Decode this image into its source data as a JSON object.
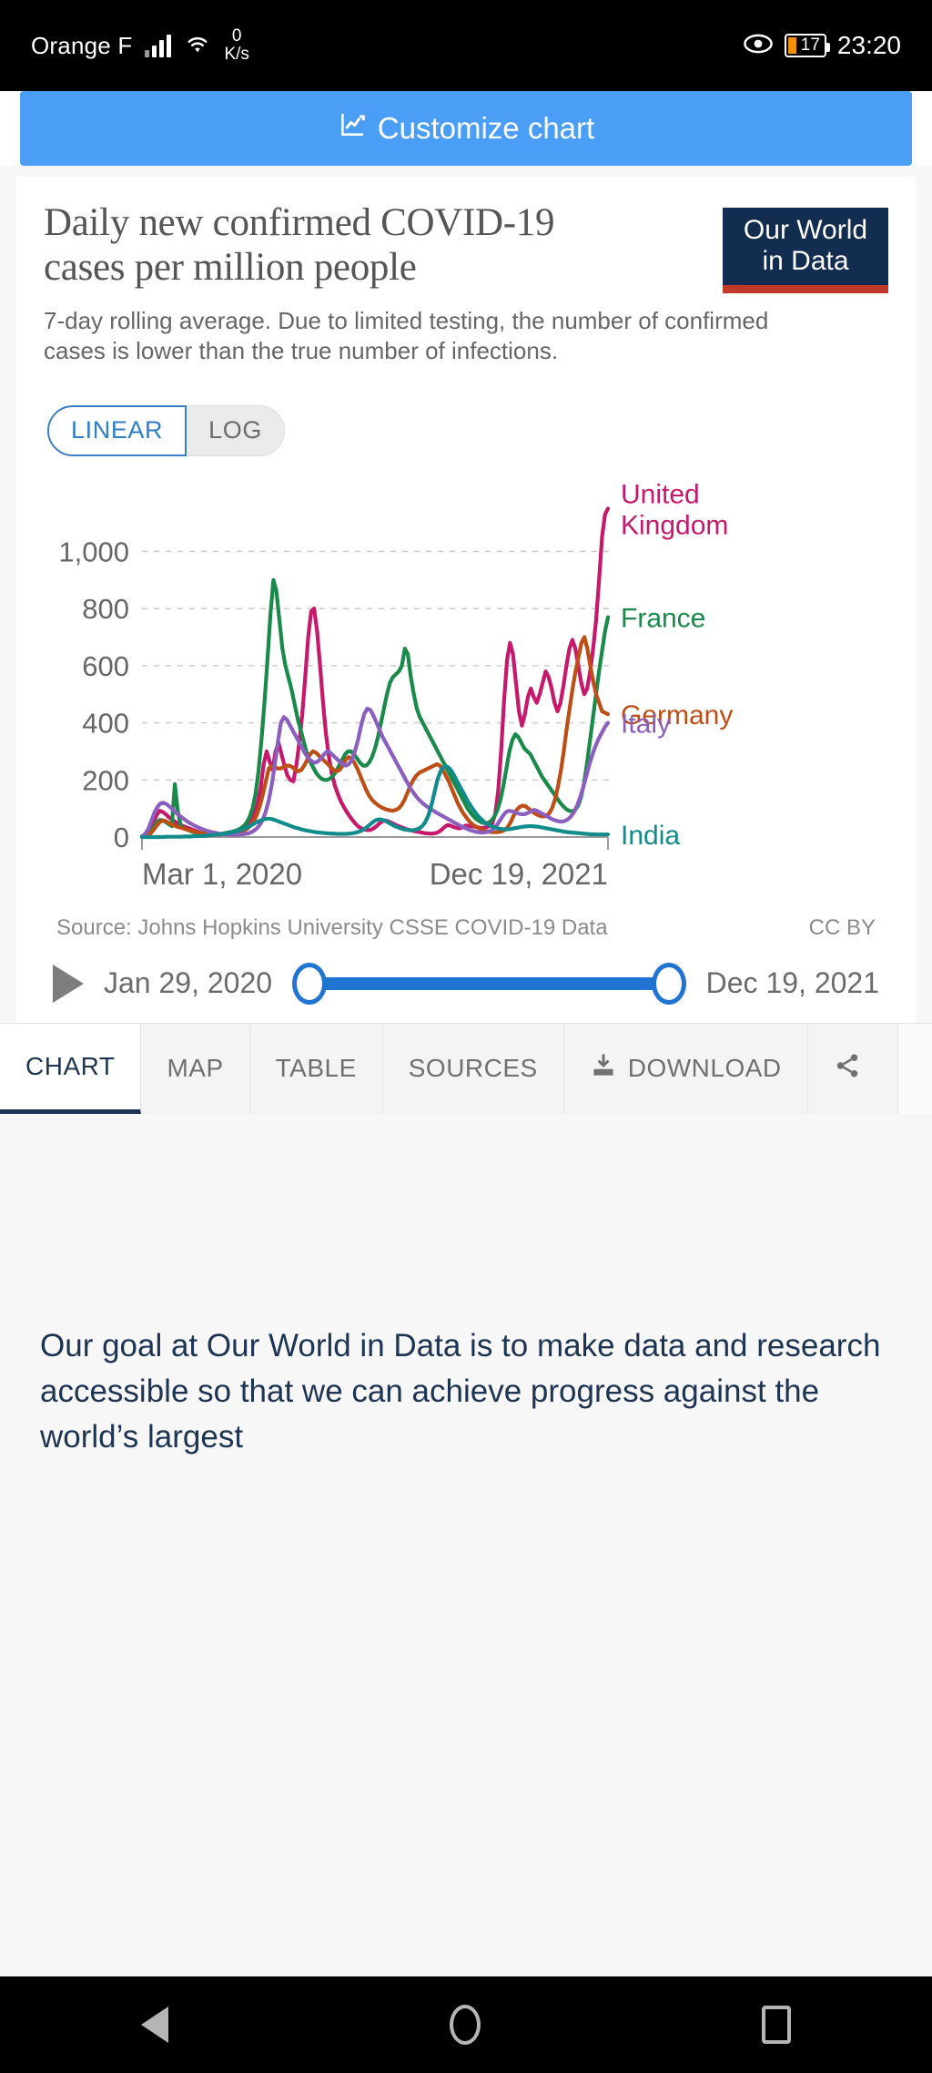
{
  "status_bar": {
    "carrier": "Orange F",
    "network_speed_value": "0",
    "network_speed_unit": "K/s",
    "battery_percent": "17",
    "time": "23:20",
    "icons": [
      "signal-icon",
      "wifi-icon",
      "eye-icon",
      "battery-icon"
    ],
    "battery_color": "#f09000"
  },
  "toolbar": {
    "customize_label": "Customize chart",
    "accent_color": "#4b9ef5",
    "icon": "chart-line-icon"
  },
  "chart_card": {
    "title": "Daily new confirmed COVID-19 cases per million people",
    "subtitle": "7-day rolling average. Due to limited testing, the number of confirmed cases is lower than the true number of infections.",
    "logo_line1": "Our World",
    "logo_line2": "in Data",
    "logo_bg": "#122d4f",
    "logo_rule": "#c0392b",
    "scale_options": [
      {
        "label": "LINEAR",
        "active": true
      },
      {
        "label": "LOG",
        "active": false
      }
    ],
    "source": "Source: Johns Hopkins University CSSE COVID-19 Data",
    "license": "CC BY"
  },
  "timeline": {
    "play_icon": "play-icon",
    "start_date": "Jan 29, 2020",
    "end_date": "Dec 19, 2021",
    "track_color": "#1f75d1"
  },
  "tabs": [
    {
      "label": "CHART",
      "active": true,
      "icon": null
    },
    {
      "label": "MAP",
      "active": false,
      "icon": null
    },
    {
      "label": "TABLE",
      "active": false,
      "icon": null
    },
    {
      "label": "SOURCES",
      "active": false,
      "icon": null
    },
    {
      "label": "DOWNLOAD",
      "active": false,
      "icon": "download-icon"
    },
    {
      "label": "",
      "active": false,
      "icon": "share-icon"
    }
  ],
  "footer": {
    "prose": "Our goal at Our World in Data is to make data and research accessible so that we can achieve progress against the world’s largest"
  },
  "nav_bar": {
    "icons": [
      "back-icon",
      "home-icon",
      "recents-icon"
    ]
  },
  "chart_data": {
    "type": "line",
    "title": "Daily new confirmed COVID-19 cases per million people",
    "subtitle": "7-day rolling average. Due to limited testing, the number of confirmed cases is lower than the true number of infections.",
    "xlabel": "",
    "ylabel": "",
    "x_tick_labels": [
      "Mar 1, 2020",
      "Dec 19, 2021"
    ],
    "x_range": [
      "2020-03-01",
      "2021-12-19"
    ],
    "y_tick_labels": [
      "0",
      "200",
      "400",
      "600",
      "800",
      "1,000"
    ],
    "y_ticks": [
      0,
      200,
      400,
      600,
      800,
      1000
    ],
    "ylim": [
      0,
      1180
    ],
    "grid": "horizontal-dashed",
    "legend_position": "right-inline-labels",
    "series": [
      {
        "name": "United Kingdom",
        "color": "#c7196c",
        "label_x_offset": 8,
        "values": [
          2,
          5,
          12,
          28,
          55,
          78,
          92,
          88,
          80,
          70,
          62,
          55,
          48,
          42,
          38,
          34,
          30,
          26,
          22,
          18,
          15,
          13,
          11,
          10,
          9,
          9,
          10,
          11,
          12,
          13,
          14,
          16,
          18,
          20,
          24,
          30,
          40,
          58,
          85,
          120,
          175,
          255,
          300,
          265,
          235,
          300,
          330,
          290,
          250,
          215,
          200,
          195,
          250,
          330,
          430,
          560,
          700,
          790,
          800,
          720,
          600,
          470,
          360,
          280,
          220,
          180,
          150,
          125,
          105,
          88,
          72,
          58,
          46,
          36,
          30,
          26,
          24,
          25,
          30,
          38,
          48,
          55,
          58,
          55,
          50,
          45,
          40,
          36,
          32,
          28,
          25,
          22,
          20,
          18,
          16,
          14,
          13,
          12,
          12,
          14,
          18,
          26,
          36,
          42,
          40,
          35,
          32,
          30,
          34,
          40,
          40,
          38,
          36,
          34,
          32,
          32,
          34,
          38,
          48,
          80,
          160,
          300,
          480,
          620,
          680,
          640,
          540,
          440,
          390,
          430,
          490,
          520,
          490,
          470,
          500,
          540,
          580,
          560,
          520,
          470,
          440,
          470,
          530,
          600,
          660,
          690,
          660,
          600,
          540,
          500,
          520,
          580,
          660,
          760,
          900,
          1050,
          1130,
          1150
        ]
      },
      {
        "name": "France",
        "color": "#1a8a4b",
        "label_x_offset": 8,
        "values": [
          1,
          3,
          8,
          18,
          35,
          52,
          60,
          58,
          52,
          45,
          38,
          185,
          90,
          40,
          30,
          26,
          22,
          18,
          15,
          13,
          11,
          10,
          9,
          8,
          8,
          9,
          10,
          12,
          14,
          16,
          18,
          21,
          25,
          30,
          38,
          50,
          70,
          100,
          150,
          230,
          340,
          470,
          620,
          780,
          900,
          860,
          760,
          660,
          600,
          560,
          520,
          470,
          420,
          380,
          340,
          300,
          270,
          250,
          230,
          215,
          205,
          200,
          200,
          205,
          215,
          230,
          250,
          270,
          290,
          300,
          300,
          290,
          275,
          260,
          250,
          250,
          260,
          280,
          310,
          350,
          400,
          450,
          500,
          540,
          560,
          570,
          580,
          600,
          660,
          640,
          560,
          500,
          450,
          420,
          400,
          380,
          360,
          340,
          320,
          300,
          280,
          260,
          240,
          220,
          200,
          180,
          160,
          140,
          120,
          100,
          85,
          72,
          62,
          55,
          50,
          48,
          50,
          58,
          72,
          95,
          130,
          180,
          240,
          300,
          340,
          360,
          350,
          330,
          310,
          300,
          290,
          270,
          250,
          230,
          210,
          195,
          180,
          165,
          150,
          135,
          120,
          108,
          98,
          92,
          90,
          95,
          110,
          140,
          190,
          260,
          340,
          420,
          500,
          580,
          650,
          720,
          770
        ]
      },
      {
        "name": "Germany",
        "color": "#bf4e16",
        "label_x_offset": 8,
        "values": [
          1,
          2,
          6,
          14,
          26,
          40,
          52,
          58,
          56,
          50,
          44,
          40,
          36,
          33,
          30,
          27,
          24,
          21,
          18,
          16,
          14,
          12,
          10,
          9,
          8,
          8,
          8,
          9,
          10,
          11,
          12,
          13,
          15,
          17,
          20,
          25,
          32,
          42,
          58,
          80,
          110,
          150,
          195,
          240,
          250,
          245,
          240,
          240,
          245,
          250,
          250,
          245,
          235,
          230,
          235,
          250,
          270,
          290,
          300,
          295,
          285,
          275,
          265,
          255,
          245,
          235,
          230,
          235,
          250,
          270,
          280,
          275,
          260,
          240,
          215,
          190,
          165,
          145,
          130,
          120,
          112,
          105,
          100,
          96,
          94,
          92,
          95,
          100,
          112,
          130,
          155,
          180,
          200,
          215,
          225,
          230,
          235,
          240,
          245,
          250,
          255,
          250,
          235,
          215,
          195,
          170,
          145,
          120,
          100,
          82,
          68,
          55,
          45,
          38,
          32,
          27,
          23,
          20,
          18,
          17,
          17,
          18,
          20,
          25,
          35,
          52,
          75,
          95,
          105,
          110,
          108,
          100,
          92,
          84,
          78,
          74,
          72,
          74,
          82,
          100,
          130,
          175,
          230,
          300,
          380,
          450,
          520,
          580,
          630,
          680,
          700,
          660,
          600,
          545,
          500,
          470,
          440,
          435,
          430
        ]
      },
      {
        "name": "Italy",
        "color": "#8b5fbf",
        "label_x_offset": 8,
        "values": [
          3,
          10,
          28,
          55,
          85,
          105,
          118,
          120,
          115,
          106,
          96,
          86,
          76,
          68,
          60,
          52,
          46,
          40,
          35,
          30,
          26,
          22,
          19,
          16,
          14,
          12,
          10,
          9,
          8,
          8,
          8,
          8,
          9,
          10,
          12,
          15,
          20,
          28,
          40,
          58,
          85,
          125,
          180,
          250,
          330,
          400,
          420,
          410,
          390,
          370,
          350,
          330,
          310,
          290,
          275,
          265,
          260,
          265,
          275,
          290,
          300,
          295,
          285,
          275,
          265,
          255,
          250,
          255,
          270,
          300,
          340,
          390,
          430,
          450,
          445,
          425,
          400,
          375,
          350,
          330,
          310,
          290,
          270,
          250,
          230,
          210,
          190,
          170,
          155,
          140,
          128,
          118,
          110,
          102,
          95,
          88,
          82,
          76,
          70,
          64,
          58,
          52,
          46,
          40,
          35,
          30,
          26,
          22,
          19,
          17,
          16,
          16,
          18,
          22,
          30,
          42,
          58,
          75,
          88,
          92,
          90,
          86,
          82,
          80,
          80,
          84,
          90,
          95,
          92,
          86,
          80,
          74,
          68,
          62,
          58,
          55,
          54,
          56,
          62,
          72,
          88,
          110,
          140,
          175,
          215,
          255,
          290,
          320,
          345,
          365,
          385,
          400
        ]
      },
      {
        "name": "India",
        "color": "#118b8b",
        "label_x_offset": 8,
        "values": [
          0,
          0,
          0,
          0,
          0,
          0,
          0,
          0,
          1,
          1,
          1,
          1,
          1,
          1,
          2,
          2,
          2,
          3,
          3,
          4,
          4,
          5,
          6,
          7,
          8,
          9,
          10,
          11,
          13,
          15,
          17,
          20,
          23,
          27,
          31,
          36,
          42,
          48,
          54,
          58,
          62,
          64,
          64,
          62,
          58,
          54,
          50,
          46,
          42,
          38,
          34,
          31,
          28,
          25,
          23,
          21,
          19,
          17,
          16,
          15,
          14,
          13,
          12,
          12,
          11,
          11,
          11,
          11,
          12,
          13,
          15,
          18,
          22,
          28,
          36,
          45,
          54,
          60,
          62,
          60,
          56,
          50,
          44,
          38,
          34,
          30,
          27,
          25,
          24,
          24,
          26,
          30,
          38,
          52,
          75,
          110,
          155,
          200,
          230,
          245,
          248,
          240,
          225,
          205,
          185,
          165,
          145,
          125,
          108,
          92,
          78,
          66,
          56,
          48,
          42,
          37,
          33,
          30,
          28,
          27,
          27,
          28,
          30,
          32,
          34,
          36,
          37,
          38,
          38,
          37,
          36,
          34,
          32,
          30,
          28,
          26,
          24,
          22,
          20,
          18,
          17,
          16,
          15,
          14,
          13,
          12,
          11,
          10,
          10,
          9,
          9,
          9,
          9,
          9
        ]
      }
    ]
  }
}
